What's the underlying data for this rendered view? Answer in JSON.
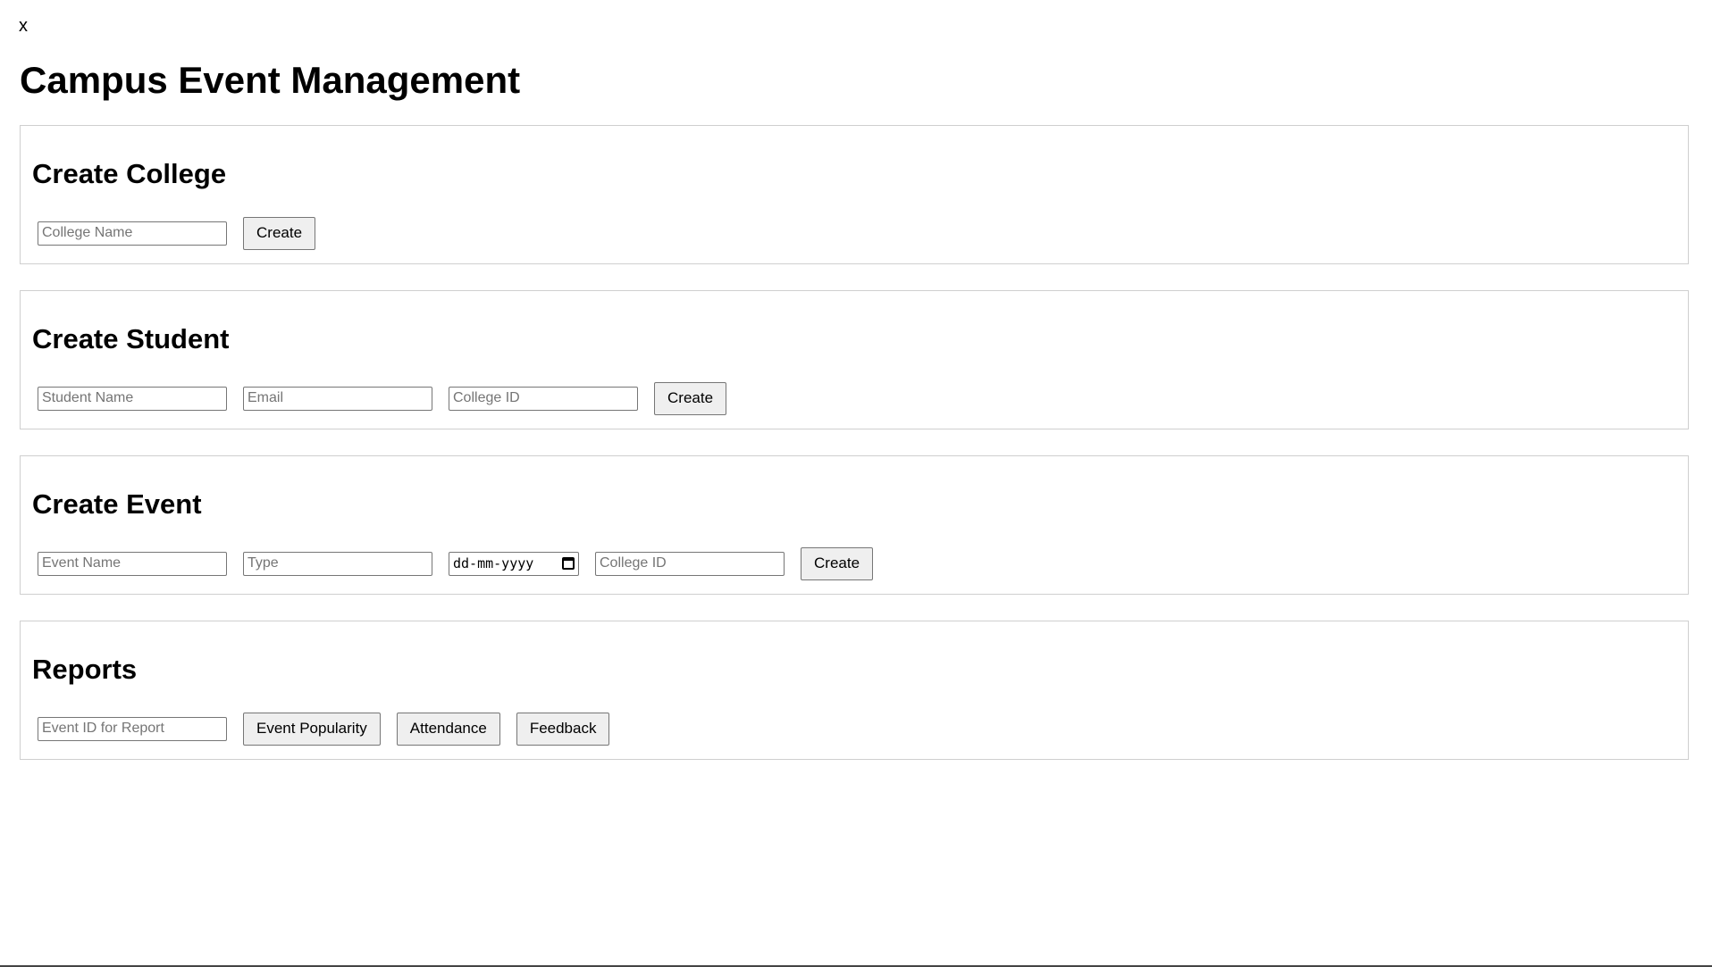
{
  "close_label": "x",
  "title": "Campus Event Management",
  "college": {
    "heading": "Create College",
    "name_placeholder": "College Name",
    "create_label": "Create"
  },
  "student": {
    "heading": "Create Student",
    "name_placeholder": "Student Name",
    "email_placeholder": "Email",
    "college_id_placeholder": "College ID",
    "create_label": "Create"
  },
  "event": {
    "heading": "Create Event",
    "name_placeholder": "Event Name",
    "type_placeholder": "Type",
    "date_placeholder": "dd-mm-yyyy",
    "college_id_placeholder": "College ID",
    "create_label": "Create"
  },
  "reports": {
    "heading": "Reports",
    "event_id_placeholder": "Event ID for Report",
    "popularity_label": "Event Popularity",
    "attendance_label": "Attendance",
    "feedback_label": "Feedback"
  },
  "icons": {
    "date_picker": "calendar-icon"
  }
}
